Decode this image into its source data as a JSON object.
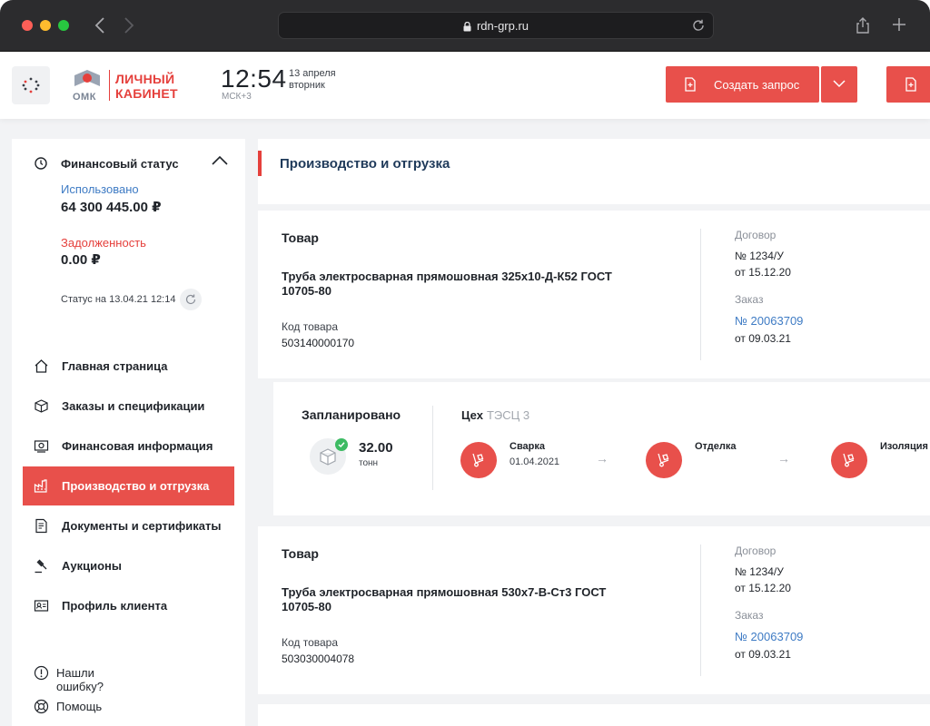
{
  "browser": {
    "url": "rdn-grp.ru"
  },
  "header": {
    "logo_line1": "ЛИЧНЫЙ",
    "logo_line2": "КАБИНЕТ",
    "logo_mark": "ОМК",
    "time": "12:54",
    "timezone": "МСК+3",
    "date": "13 апреля",
    "weekday": "вторник",
    "create_label": "Создать запрос",
    "accent": "#e8504b"
  },
  "sidebar": {
    "financial": {
      "title": "Финансовый статус",
      "used_label": "Использовано",
      "used_value": "64 300 445.00 ₽",
      "debt_label": "Задолженность",
      "debt_value": "0.00 ₽",
      "status": "Статус на 13.04.21 12:14"
    },
    "items": [
      {
        "label": "Главная страница",
        "icon": "home-icon"
      },
      {
        "label": "Заказы и спецификации",
        "icon": "orders-icon"
      },
      {
        "label": "Финансовая информация",
        "icon": "finance-icon"
      },
      {
        "label": "Производство и отгрузка",
        "icon": "factory-icon",
        "active": true
      },
      {
        "label": "Документы и сертификаты",
        "icon": "documents-icon"
      },
      {
        "label": "Аукционы",
        "icon": "gavel-icon"
      },
      {
        "label": "Профиль клиента",
        "icon": "profile-icon"
      }
    ],
    "help": [
      {
        "label": "Нашли ошибку?",
        "icon": "info-icon"
      },
      {
        "label": "Помощь",
        "icon": "lifebuoy-icon"
      }
    ]
  },
  "main": {
    "title": "Производство и отгрузка",
    "products": [
      {
        "section_label": "Товар",
        "name": "Труба электросварная прямошовная 325х10-Д-К52 ГОСТ 10705-80",
        "code_label": "Код товара",
        "code": "503140000170",
        "contract_label": "Договор",
        "contract_num": "№ 1234/У",
        "contract_date": "от 15.12.20",
        "order_label": "Заказ",
        "order_num": "№ 20063709",
        "order_date": "от 09.03.21"
      },
      {
        "section_label": "Товар",
        "name": "Труба электросварная прямошовная 530х7-В-Ст3 ГОСТ 10705-80",
        "code_label": "Код товара",
        "code": "503030004078",
        "contract_label": "Договор",
        "contract_num": "№ 1234/У",
        "contract_date": "от 15.12.20",
        "order_label": "Заказ",
        "order_num": "№ 20063709",
        "order_date": "от 09.03.21"
      }
    ],
    "plan": {
      "title": "Запланировано",
      "value": "32.00",
      "unit": "тонн",
      "shop_label": "Цех",
      "shop_value": "ТЭСЦ 3",
      "stages": [
        {
          "name": "Сварка",
          "date": "01.04.2021"
        },
        {
          "name": "Отделка",
          "date": ""
        },
        {
          "name": "Изоляция",
          "date": ""
        }
      ],
      "arrow": "→"
    }
  }
}
